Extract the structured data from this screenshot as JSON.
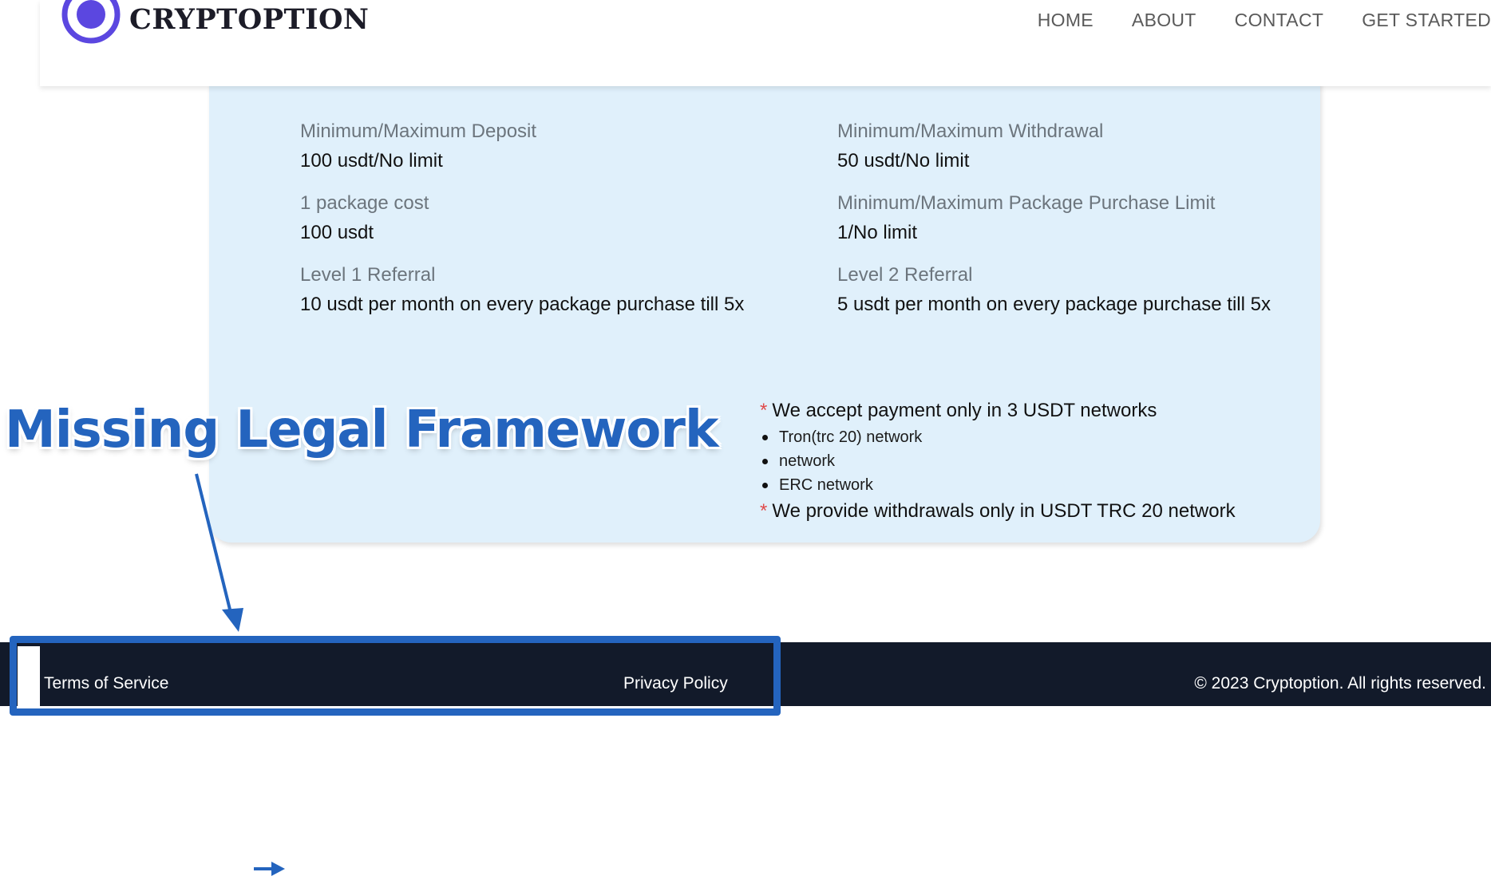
{
  "header": {
    "brand": "CRYPTOPTION",
    "nav": [
      "HOME",
      "ABOUT",
      "CONTACT",
      "GET STARTED"
    ]
  },
  "info": {
    "min_max_deposit": {
      "label": "Minimum/Maximum Deposit",
      "value": "100 usdt/No limit"
    },
    "min_max_withdrawal": {
      "label": "Minimum/Maximum Withdrawal",
      "value": "50 usdt/No limit"
    },
    "package_cost": {
      "label": "1 package cost",
      "value": "100 usdt"
    },
    "package_limit": {
      "label": "Minimum/Maximum Package Purchase Limit",
      "value": "1/No limit"
    },
    "level1": {
      "label": "Level 1 Referral",
      "value": "10 usdt per month on every package purchase till 5x"
    },
    "level2": {
      "label": "Level 2 Referral",
      "value": "5 usdt per month on every package purchase till 5x"
    }
  },
  "notes": {
    "star": "*",
    "payment_note": "We accept payment only in 3 USDT networks",
    "networks": [
      "Tron(trc 20) network",
      "network",
      "ERC network"
    ],
    "withdrawal_note": "We provide withdrawals only in USDT TRC 20 network"
  },
  "footer": {
    "terms": "Terms of Service",
    "privacy": "Privacy Policy",
    "copyright": "© 2023 Cryptoption. All rights reserved."
  },
  "annotation": {
    "title": "Missing Legal Framework",
    "color": "#2464be"
  },
  "colors": {
    "card_bg": "#e0f0fb",
    "footer_bg": "#121a2a",
    "logo": "#5b47e0",
    "required_star": "#e04a4a"
  },
  "icons": {
    "logo": "ring-logo-icon",
    "arrow": "arrow-annotation-icon",
    "small_arrow": "small-arrow-icon"
  }
}
